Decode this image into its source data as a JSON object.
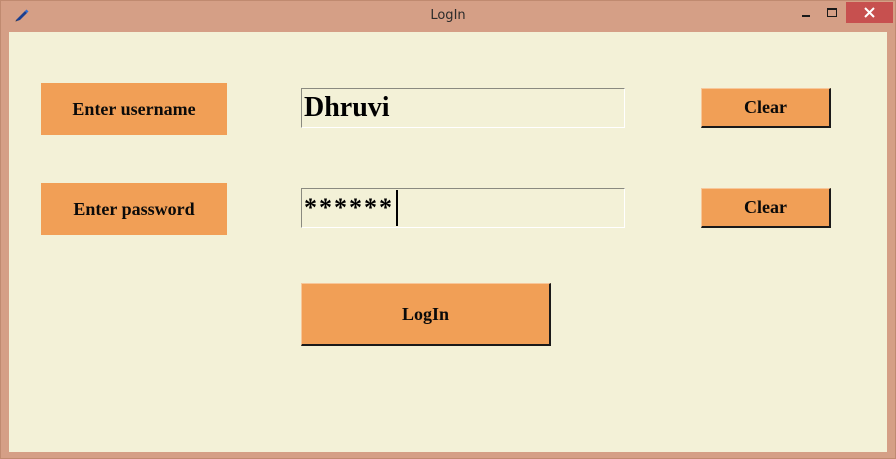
{
  "window": {
    "title": "LogIn",
    "icons": {
      "app": "pencil-icon",
      "minimize": "minimize-icon",
      "maximize": "maximize-icon",
      "close": "close-icon"
    },
    "colors": {
      "frame": "#d59f86",
      "background": "#f3f1d7",
      "accent": "#f19f56",
      "close_button": "#c7504f"
    }
  },
  "form": {
    "username": {
      "label": "Enter username",
      "value": "Dhruvi",
      "clear_label": "Clear"
    },
    "password": {
      "label": "Enter password",
      "value": "******",
      "clear_label": "Clear"
    },
    "login_label": "LogIn"
  }
}
